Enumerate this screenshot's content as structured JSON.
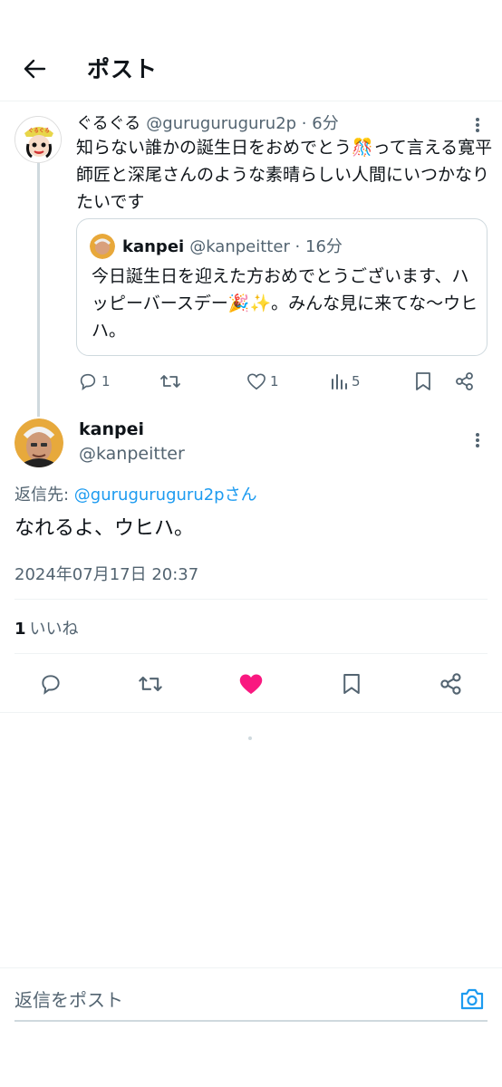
{
  "header": {
    "title": "ポスト"
  },
  "parent_post": {
    "name": "ぐるぐる",
    "handle_time": "@guruguruguru2p · 6分",
    "text": "知らない誰かの誕生日をおめでとう🎊って言える寛平師匠と深尾さんのような素晴らしい人間にいつかなりたいです",
    "quote": {
      "name": "kanpei",
      "handle_time": "@kanpeitter · 16分",
      "text": "今日誕生日を迎えた方おめでとうございます、ハッピーバースデー🎉✨。みんな見に来てな〜ウヒハ。"
    },
    "actions": {
      "replies": "1",
      "likes": "1",
      "views": "5"
    }
  },
  "main_post": {
    "name": "kanpei",
    "handle": "@kanpeitter",
    "reply_prefix": "返信先: ",
    "reply_to": "@guruguruguru2pさん",
    "text": "なれるよ、ウヒハ。",
    "timestamp": "2024年07月17日 20:37",
    "like_count": "1",
    "like_label": "いいね"
  },
  "composer": {
    "placeholder": "返信をポスト"
  },
  "colors": {
    "accent": "#1d9bf0",
    "like": "#f91880",
    "muted": "#536471"
  }
}
